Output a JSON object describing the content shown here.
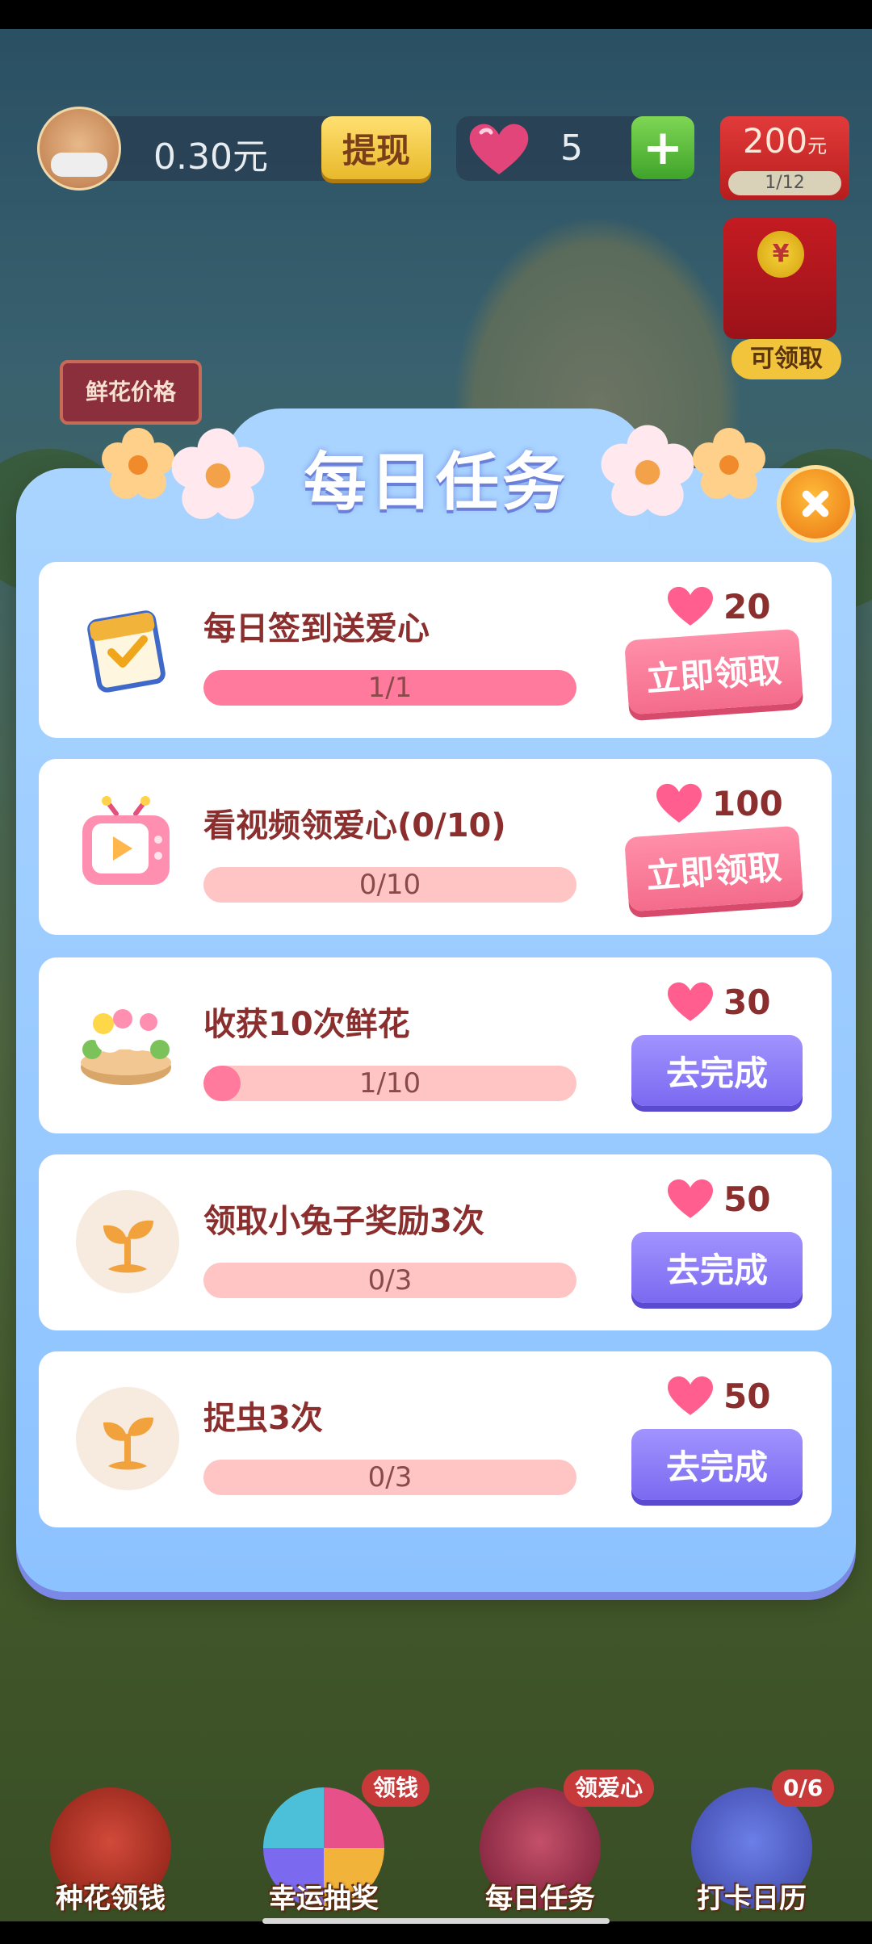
{
  "hud": {
    "balance": "0.30元",
    "withdraw_label": "提现",
    "hearts": "5",
    "plus_label": "+",
    "red_amount": "200",
    "red_unit": "元",
    "red_progress": "1/12",
    "claimable_label": "可领取",
    "coin_symbol": "¥"
  },
  "scene": {
    "flower_price_sign": "鲜花价格"
  },
  "modal": {
    "title": "每日任务",
    "tasks": [
      {
        "title": "每日签到送爱心",
        "progress": "1/1",
        "fill": 1.0,
        "reward": "20",
        "button": "立即领取",
        "button_type": "claim"
      },
      {
        "title": "看视频领爱心(0/10)",
        "progress": "0/10",
        "fill": 0.0,
        "reward": "100",
        "button": "立即领取",
        "button_type": "claim"
      },
      {
        "title": "收获10次鲜花",
        "progress": "1/10",
        "fill": 0.1,
        "reward": "30",
        "button": "去完成",
        "button_type": "go"
      },
      {
        "title": "领取小兔子奖励3次",
        "progress": "0/3",
        "fill": 0.0,
        "reward": "50",
        "button": "去完成",
        "button_type": "go"
      },
      {
        "title": "捉虫3次",
        "progress": "0/3",
        "fill": 0.0,
        "reward": "50",
        "button": "去完成",
        "button_type": "go"
      }
    ]
  },
  "nav": {
    "items": [
      {
        "label": "种花领钱",
        "badge": ""
      },
      {
        "label": "幸运抽奖",
        "badge": "领钱"
      },
      {
        "label": "每日任务",
        "badge": "领爱心"
      },
      {
        "label": "打卡日历",
        "badge": "0/6"
      }
    ]
  },
  "colors": {
    "accent_pink": "#f46c8b",
    "accent_purple": "#7b69f0",
    "modal_blue": "#8cc2ff",
    "text_brown": "#8a2e2e"
  }
}
